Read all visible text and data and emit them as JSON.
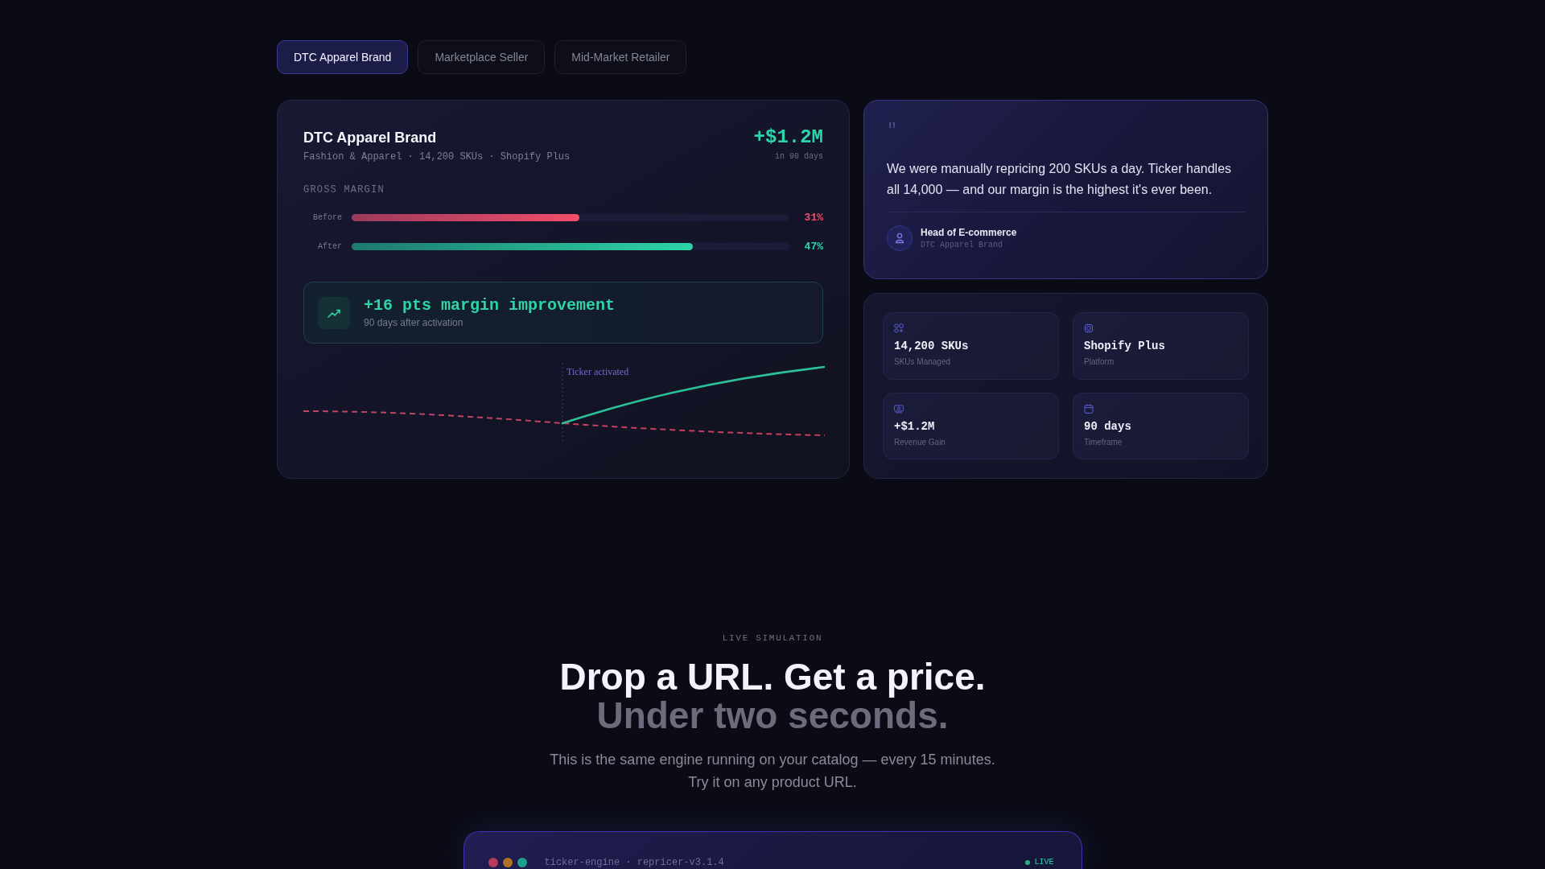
{
  "tabs": [
    {
      "label": "DTC Apparel Brand",
      "selected": true
    },
    {
      "label": "Marketplace Seller",
      "selected": false
    },
    {
      "label": "Mid-Market Retailer",
      "selected": false
    }
  ],
  "case_card": {
    "title": "DTC Apparel Brand",
    "subtitle": "Fashion & Apparel · 14,200 SKUs · Shopify Plus",
    "gain": "+$1.2M",
    "gain_period": "in 90 days",
    "section_label": "GROSS MARGIN",
    "bars": [
      {
        "kind": "before",
        "label": "Before",
        "level": 0.52,
        "reading": "31%"
      },
      {
        "kind": "after",
        "label": "After",
        "level": 0.78,
        "reading": "47%"
      }
    ],
    "highlight": {
      "title": "+16 pts margin improvement",
      "subtitle": "90 days after activation"
    },
    "trend_chart": {
      "annotation": "Ticker activated"
    }
  },
  "testimonial": {
    "quote_mark": "\"",
    "quote": "We were manually repricing 200 SKUs a day. Ticker handles all 14,000 — and our margin is the highest it's ever been.",
    "author": "Head of E-commerce",
    "company": "DTC Apparel Brand"
  },
  "stats": [
    {
      "kind": "skus",
      "value": "14,200 SKUs",
      "label": "SKUs Managed"
    },
    {
      "kind": "platform",
      "value": "Shopify Plus",
      "label": "Platform"
    },
    {
      "kind": "revenue",
      "value": "+$1.2M",
      "label": "Revenue Gain"
    },
    {
      "kind": "timeframe",
      "value": "90 days",
      "label": "Timeframe"
    }
  ],
  "live_section": {
    "eyebrow": "LIVE SIMULATION",
    "heading": "Drop a URL. Get a price.",
    "heading_muted": "Under two seconds.",
    "description": "This is the same engine running on your catalog — every 15 minutes. Try it on any product URL.",
    "terminal": {
      "title": "ticker-engine · repricer-v3.1.4",
      "status": "LIVE"
    }
  }
}
